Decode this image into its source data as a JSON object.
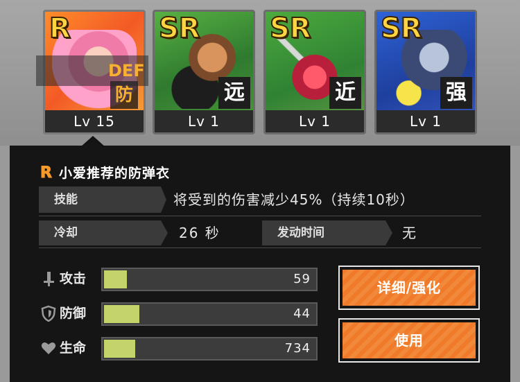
{
  "cards": [
    {
      "rarity": "R",
      "type": "防",
      "level": "Lv 15",
      "selected": true
    },
    {
      "rarity": "SR",
      "type": "远",
      "level": "Lv 1",
      "selected": false
    },
    {
      "rarity": "SR",
      "type": "近",
      "level": "Lv 1",
      "selected": false
    },
    {
      "rarity": "SR",
      "type": "强",
      "level": "Lv 1",
      "selected": false
    }
  ],
  "banner_text": "DEF",
  "detail": {
    "rarity": "R",
    "name": "小爱推荐的防弹衣",
    "skill_label": "技能",
    "skill_text": "将受到的伤害减少45%（持续10秒）",
    "cooldown_label": "冷却",
    "cooldown_value": "26 秒",
    "activation_label": "发动时间",
    "activation_value": "无"
  },
  "stats": [
    {
      "icon": "sword-icon",
      "label": "攻击",
      "value": "59",
      "fill": 0.12
    },
    {
      "icon": "shield-icon",
      "label": "防御",
      "value": "44",
      "fill": 0.18
    },
    {
      "icon": "heart-icon",
      "label": "生命",
      "value": "734",
      "fill": 0.16
    }
  ],
  "buttons": {
    "detail": "详细/强化",
    "use": "使用"
  },
  "colors": {
    "accent": "#f17a2a",
    "bar_fill": "#c5d46a",
    "rarity_r": "#f49a2a",
    "rarity_sr": "#ffd642"
  }
}
